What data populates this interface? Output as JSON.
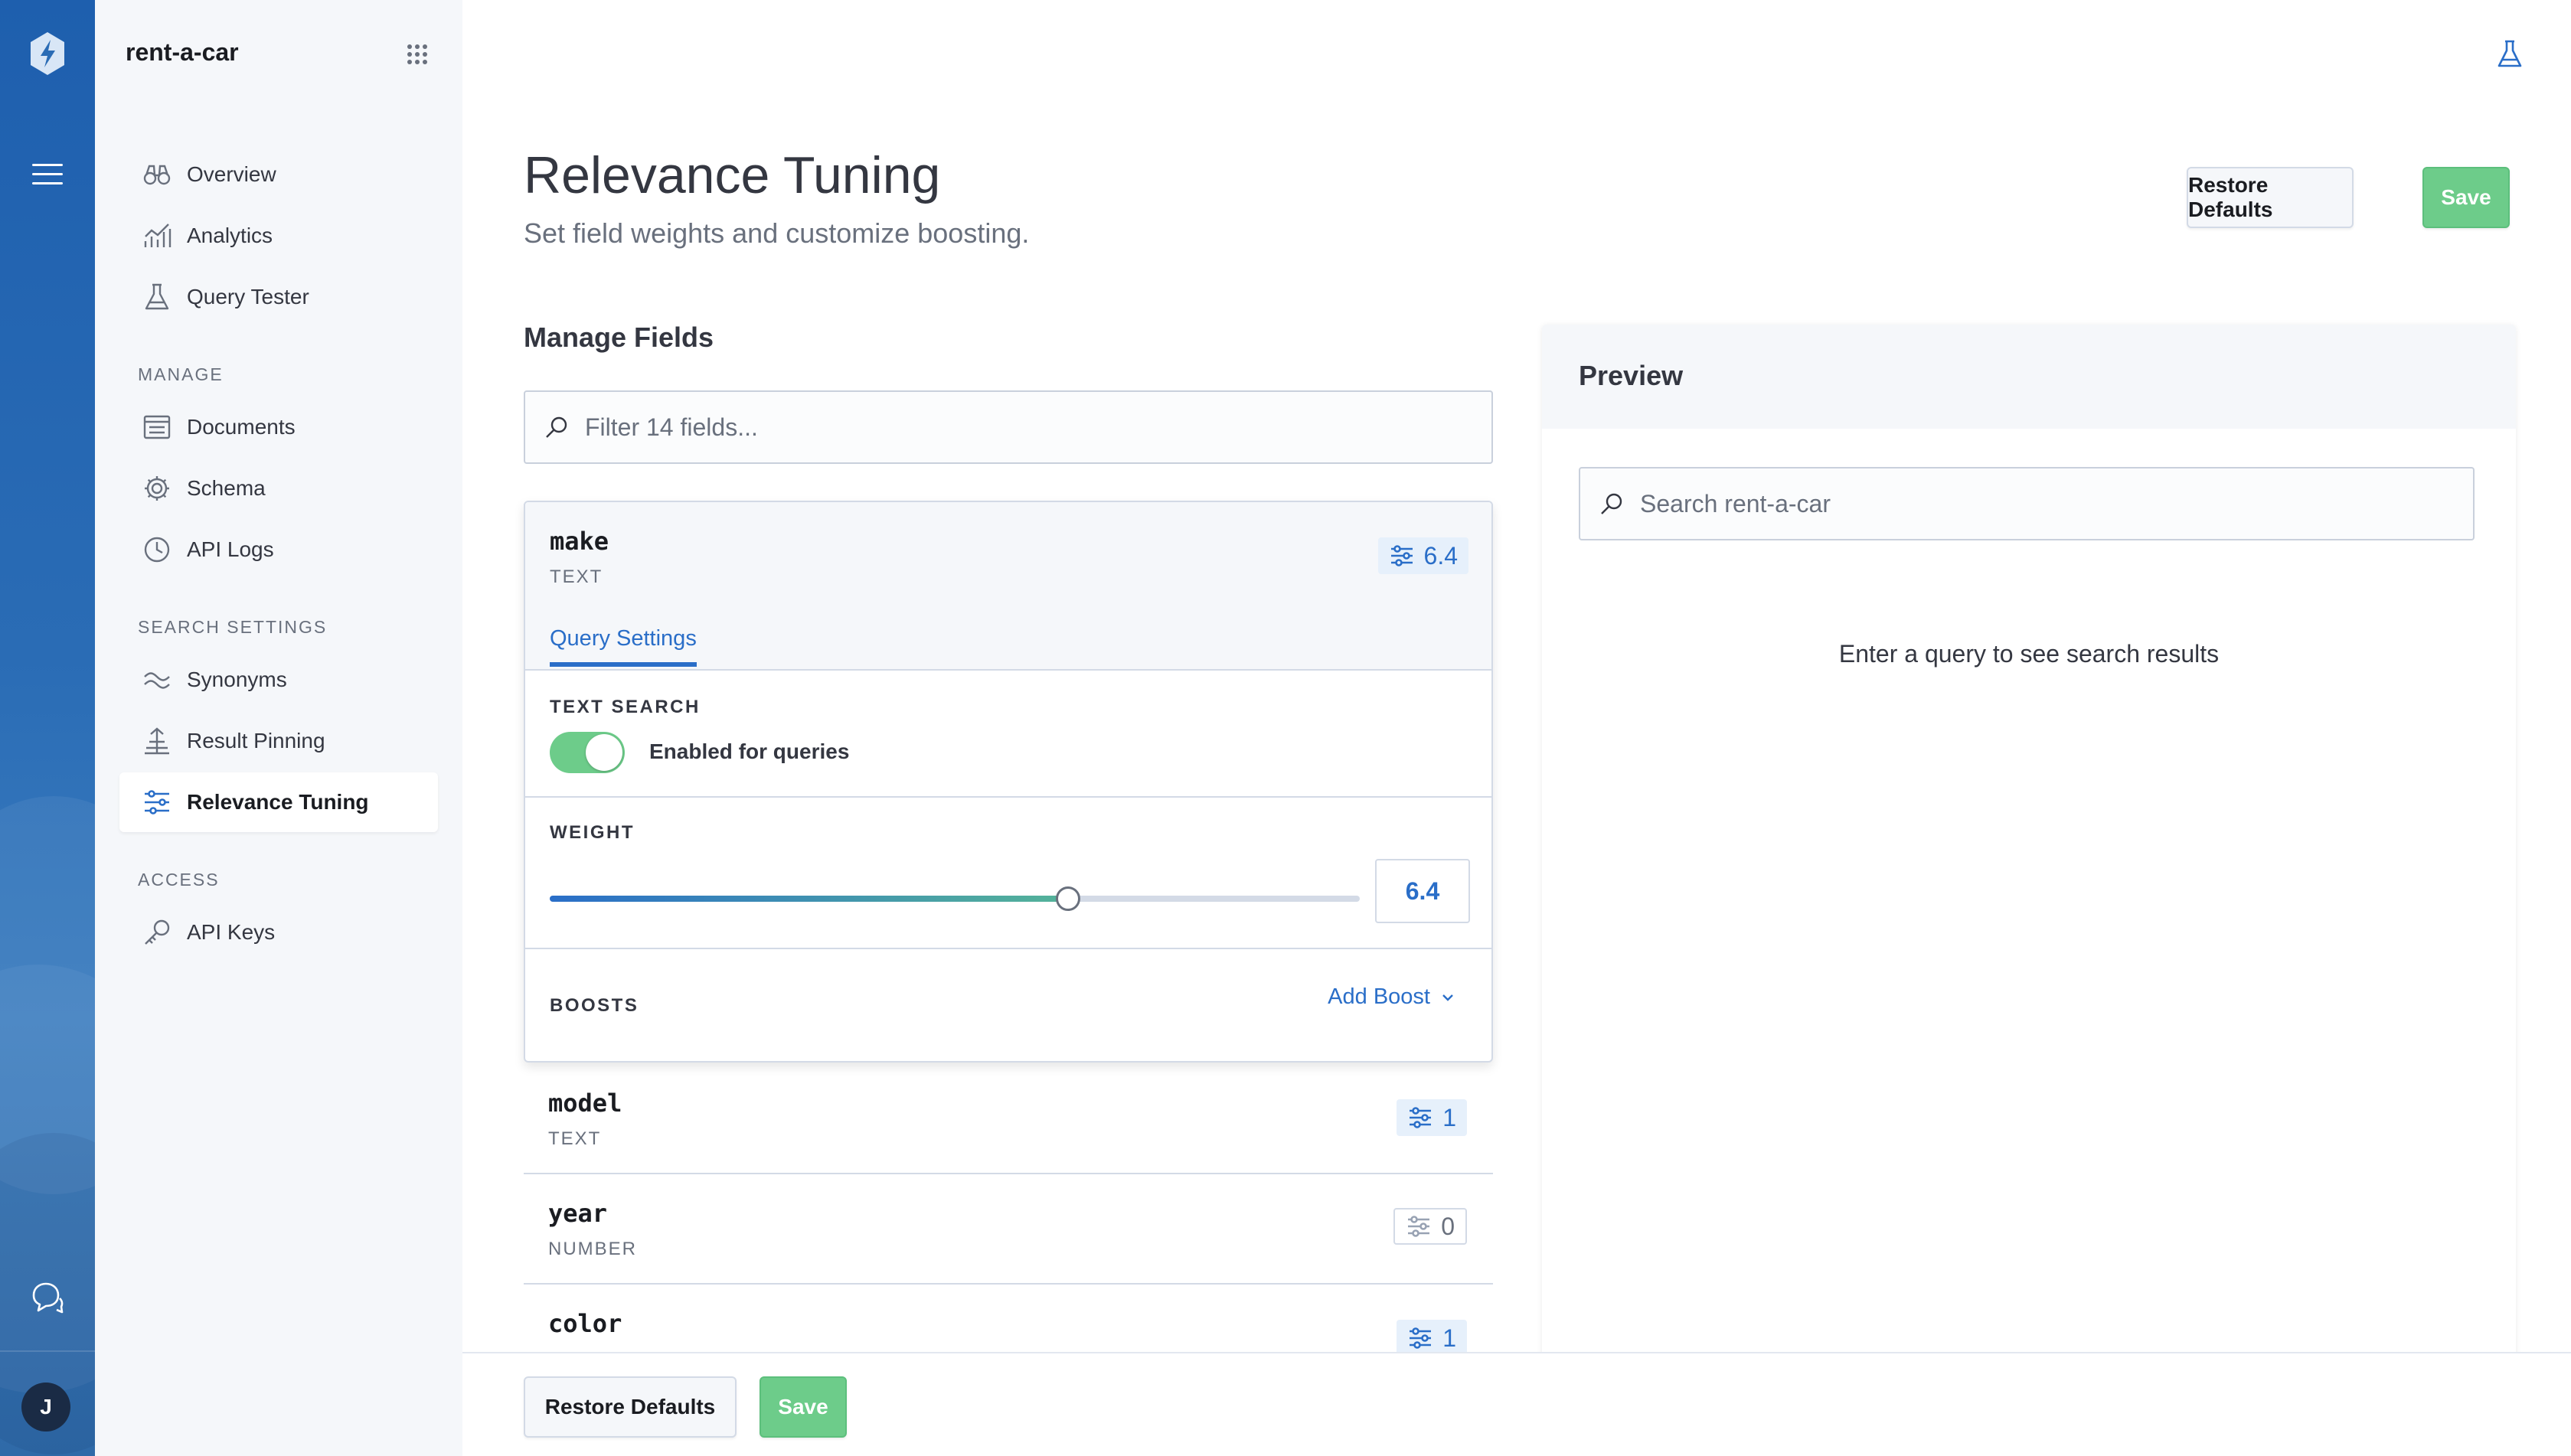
{
  "rail": {
    "avatar_initial": "J",
    "icons": [
      "app-logo-icon",
      "menu-icon",
      "chat-icon"
    ]
  },
  "sidebar": {
    "engine_name": "rent-a-car",
    "top_items": [
      {
        "label": "Overview",
        "icon": "binoculars-icon"
      },
      {
        "label": "Analytics",
        "icon": "chart-icon"
      },
      {
        "label": "Query Tester",
        "icon": "flask-icon"
      }
    ],
    "manage_label": "MANAGE",
    "manage_items": [
      {
        "label": "Documents",
        "icon": "document-icon"
      },
      {
        "label": "Schema",
        "icon": "gear-icon"
      },
      {
        "label": "API Logs",
        "icon": "clock-icon"
      }
    ],
    "search_settings_label": "SEARCH SETTINGS",
    "search_items": [
      {
        "label": "Synonyms",
        "icon": "wave-icon"
      },
      {
        "label": "Result Pinning",
        "icon": "pin-icon"
      },
      {
        "label": "Relevance Tuning",
        "icon": "sliders-icon",
        "active": true
      }
    ],
    "access_label": "ACCESS",
    "access_items": [
      {
        "label": "API Keys",
        "icon": "key-icon"
      }
    ]
  },
  "header": {
    "title": "Relevance Tuning",
    "subtitle": "Set field weights and customize boosting.",
    "restore_label": "Restore Defaults",
    "save_label": "Save"
  },
  "manage_fields": {
    "title": "Manage Fields",
    "filter_placeholder": "Filter 14 fields..."
  },
  "expanded_field": {
    "name": "make",
    "type": "TEXT",
    "weight": "6.4",
    "weight_fraction": 0.64,
    "tab_label": "Query Settings",
    "text_search_label": "TEXT SEARCH",
    "toggle_label": "Enabled for queries",
    "toggle_on": true,
    "weight_label": "WEIGHT",
    "boosts_label": "BOOSTS",
    "add_boost_label": "Add Boost"
  },
  "fields": [
    {
      "name": "model",
      "type": "TEXT",
      "weight": "1",
      "active": true
    },
    {
      "name": "year",
      "type": "NUMBER",
      "weight": "0",
      "active": false
    },
    {
      "name": "color",
      "type": "",
      "weight": "1",
      "active": true
    }
  ],
  "preview": {
    "title": "Preview",
    "search_placeholder": "Search rent-a-car",
    "empty_text": "Enter a query to see search results"
  },
  "bottom_bar": {
    "restore_label": "Restore Defaults",
    "save_label": "Save"
  },
  "colors": {
    "accent": "#2a6ec8",
    "success": "#6dcc8a",
    "rail": "#1e5fae"
  }
}
